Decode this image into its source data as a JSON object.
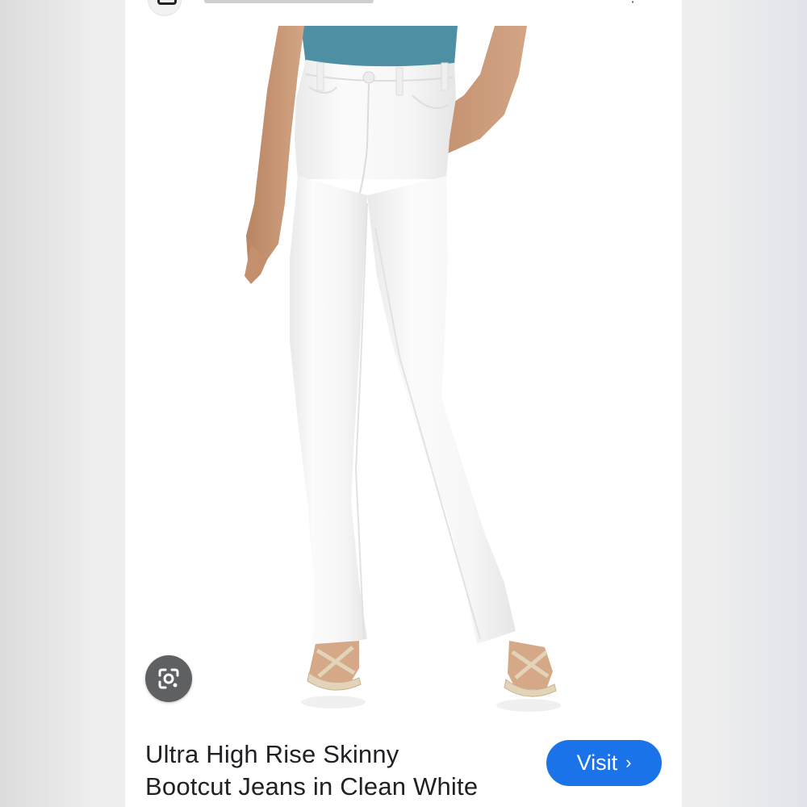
{
  "product": {
    "title_line1": "Ultra High Rise Skinny",
    "title_line2": "Bootcut Jeans in Clean White"
  },
  "actions": {
    "visit_label": "Visit",
    "visit_chevron": "›"
  },
  "icons": {
    "lens": "google-lens-icon",
    "source": "source-favicon-icon",
    "chevron": "chevron-right-icon"
  },
  "colors": {
    "visit_button": "#1a73e8",
    "lens_button": "#5f6062",
    "top_shirt": "#4f8fa3",
    "jeans": "#f7f7f7",
    "skin": "#c99a78",
    "text": "#202124"
  }
}
